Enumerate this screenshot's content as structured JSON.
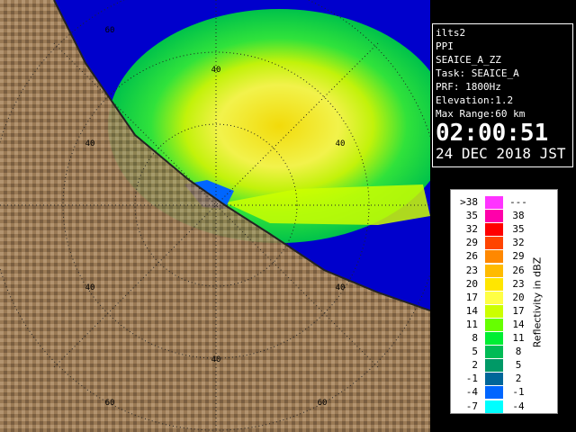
{
  "info": {
    "site": "ilts2",
    "mode": "PPI",
    "product": "SEAICE_A_ZZ",
    "task": "Task: SEAICE_A",
    "prf": "PRF: 1800Hz",
    "elevation": "Elevation:1.2",
    "max_range": "Max Range:60 km",
    "time": "02:00:51",
    "date": "24 DEC 2018 JST"
  },
  "range_labels": [
    "40",
    "60"
  ],
  "legend": {
    "title": "Reflectivity in dBZ",
    "rows": [
      {
        "lo": ">38",
        "hi": "---",
        "color": "#ff33ff"
      },
      {
        "lo": "35",
        "hi": "38",
        "color": "#ff00aa"
      },
      {
        "lo": "32",
        "hi": "35",
        "color": "#ff0000"
      },
      {
        "lo": "29",
        "hi": "32",
        "color": "#ff4400"
      },
      {
        "lo": "26",
        "hi": "29",
        "color": "#ff8800"
      },
      {
        "lo": "23",
        "hi": "26",
        "color": "#ffbb00"
      },
      {
        "lo": "20",
        "hi": "23",
        "color": "#ffe600"
      },
      {
        "lo": "17",
        "hi": "20",
        "color": "#ffff44"
      },
      {
        "lo": "14",
        "hi": "17",
        "color": "#ccff00"
      },
      {
        "lo": "11",
        "hi": "14",
        "color": "#66ff00"
      },
      {
        "lo": "8",
        "hi": "11",
        "color": "#00ee33"
      },
      {
        "lo": "5",
        "hi": "8",
        "color": "#00bb55"
      },
      {
        "lo": "2",
        "hi": "5",
        "color": "#009966"
      },
      {
        "lo": "-1",
        "hi": "2",
        "color": "#006699"
      },
      {
        "lo": "-4",
        "hi": "-1",
        "color": "#0066ff"
      },
      {
        "lo": "-7",
        "hi": "-4",
        "color": "#00ffff"
      }
    ]
  },
  "colors": {
    "sea": "#0000cc",
    "land": "#9a7a55",
    "echo_outer": "#00ee33",
    "echo_mid": "#ccff00",
    "echo_core": "#ffe600",
    "coast_echo": "#0066ff"
  }
}
